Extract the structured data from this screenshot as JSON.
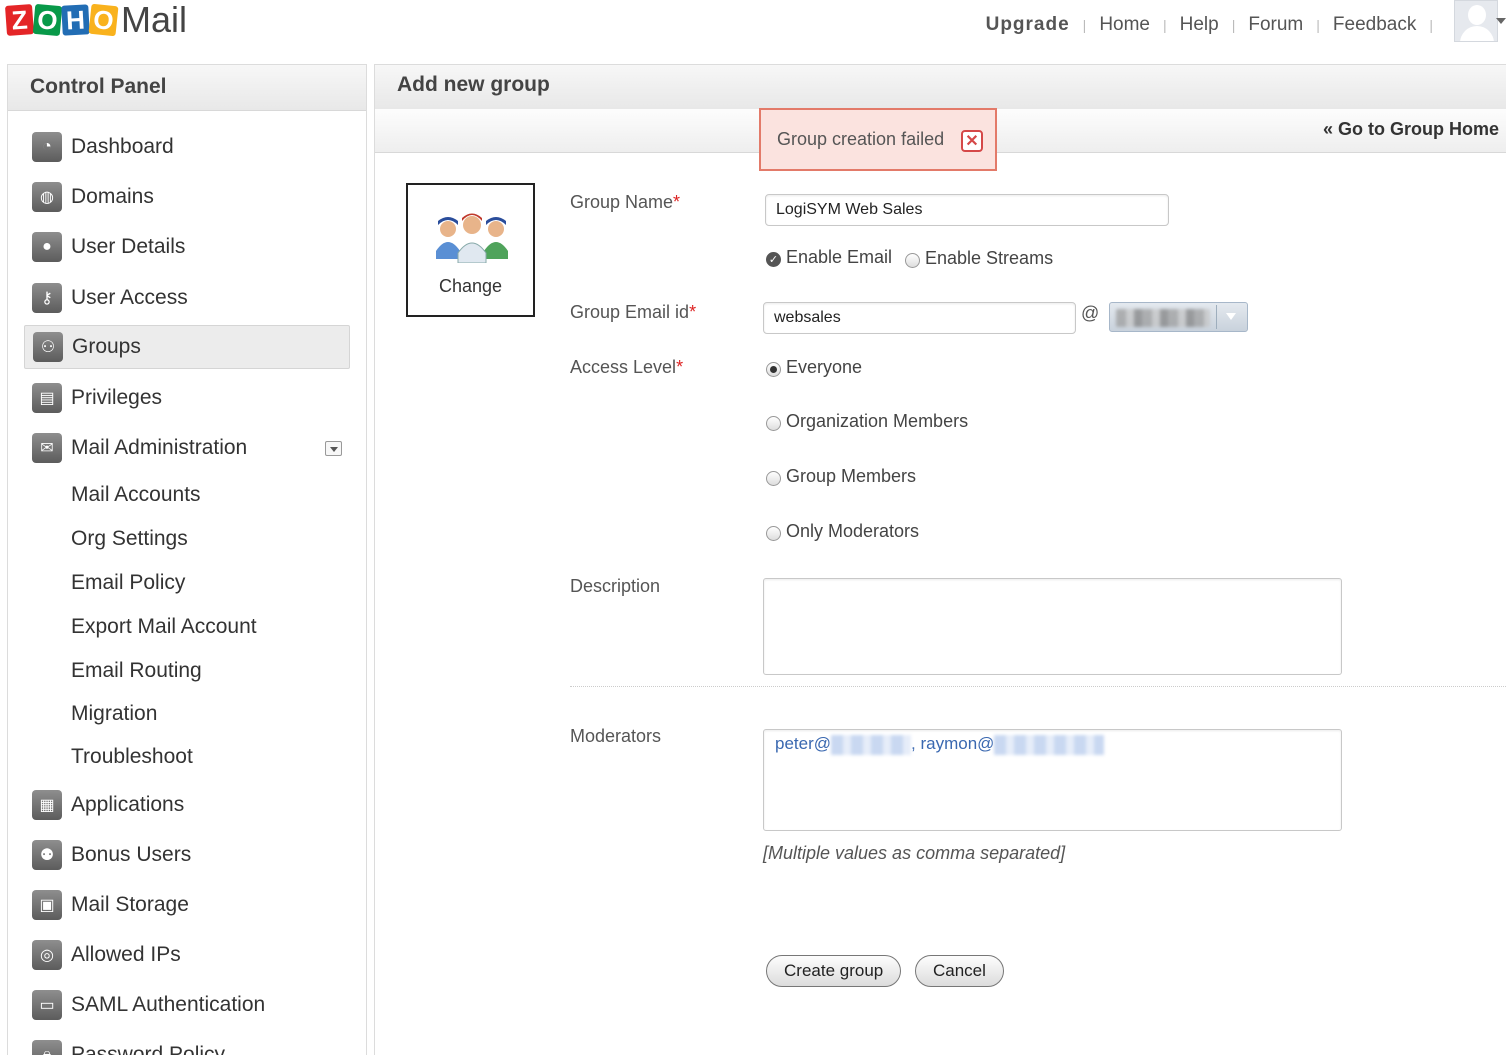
{
  "logo": {
    "letters": [
      "Z",
      "O",
      "H",
      "O"
    ],
    "colors": [
      "#e42527",
      "#089949",
      "#226db4",
      "#f9b21d"
    ],
    "product": "Mail"
  },
  "topnav": {
    "items": [
      "Upgrade",
      "Home",
      "Help",
      "Forum",
      "Feedback"
    ]
  },
  "sidebar": {
    "title": "Control Panel",
    "items": [
      {
        "label": "Dashboard",
        "icon": "dashboard-icon"
      },
      {
        "label": "Domains",
        "icon": "globe-icon"
      },
      {
        "label": "User Details",
        "icon": "user-icon"
      },
      {
        "label": "User Access",
        "icon": "user-key-icon"
      },
      {
        "label": "Groups",
        "icon": "group-icon",
        "active": true
      },
      {
        "label": "Privileges",
        "icon": "document-icon"
      },
      {
        "label": "Mail Administration",
        "icon": "envelope-icon",
        "expanded": true
      }
    ],
    "mail_admin_sub": [
      "Mail Accounts",
      "Org Settings",
      "Email Policy",
      "Export Mail Account",
      "Email Routing",
      "Migration",
      "Troubleshoot"
    ],
    "items2": [
      {
        "label": "Applications",
        "icon": "applications-icon"
      },
      {
        "label": "Bonus Users",
        "icon": "users-icon"
      },
      {
        "label": "Mail Storage",
        "icon": "storage-icon"
      },
      {
        "label": "Allowed IPs",
        "icon": "network-icon"
      },
      {
        "label": "SAML Authentication",
        "icon": "monitor-icon"
      },
      {
        "label": "Password Policy",
        "icon": "lock-icon"
      }
    ]
  },
  "main": {
    "title": "Add new group",
    "goto_link": "« Go to Group Home",
    "alert": "Group creation failed",
    "change_label": "Change"
  },
  "form": {
    "group_name_label": "Group Name",
    "group_name_value": "LogiSYM Web Sales",
    "enable_email": "Enable Email",
    "enable_streams": "Enable Streams",
    "group_email_label": "Group Email id",
    "group_email_value": "websales",
    "at": "@",
    "access_label": "Access Level",
    "access_options": [
      "Everyone",
      "Organization Members",
      "Group Members",
      "Only Moderators"
    ],
    "access_selected": "Everyone",
    "description_label": "Description",
    "description_value": "",
    "moderators_label": "Moderators",
    "moderator_1": "peter@",
    "moderator_sep": ", raymon@",
    "hint": "[Multiple values as comma separated]",
    "create_button": "Create group",
    "cancel_button": "Cancel"
  }
}
